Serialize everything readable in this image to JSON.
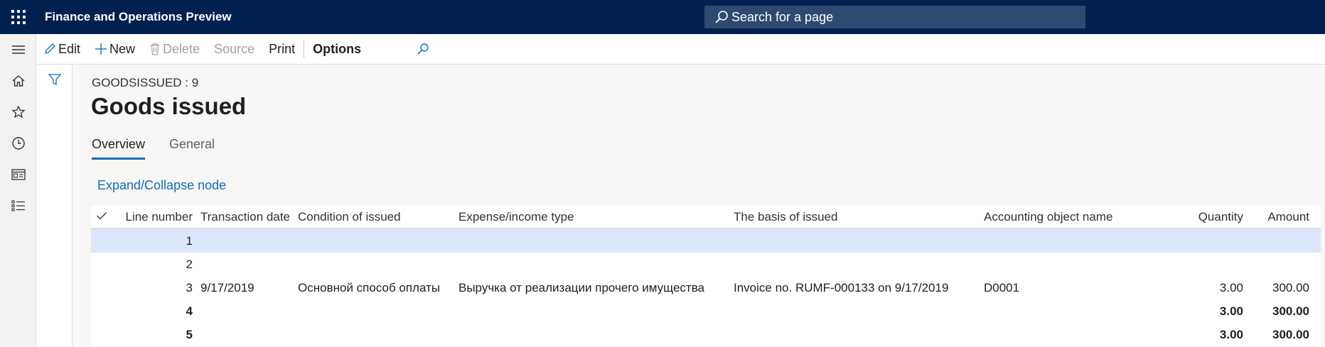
{
  "header": {
    "app_title": "Finance and Operations Preview",
    "search_placeholder": "Search for a page",
    "waffle_icon": "waffle-icon"
  },
  "rail": {
    "items": [
      "hamburger-icon",
      "home-icon",
      "star-icon",
      "clock-icon",
      "workspace-icon",
      "list-icon"
    ]
  },
  "actions": {
    "edit": "Edit",
    "new": "New",
    "delete": "Delete",
    "source": "Source",
    "print": "Print",
    "options": "Options"
  },
  "page": {
    "caption": "GOODSISSUED : 9",
    "title": "Goods issued",
    "tabs": [
      {
        "label": "Overview",
        "active": true
      },
      {
        "label": "General",
        "active": false
      }
    ],
    "expand_link": "Expand/Collapse node"
  },
  "grid": {
    "columns": {
      "line_number": "Line number",
      "transaction_date": "Transaction date",
      "condition": "Condition of issued",
      "expense_type": "Expense/income type",
      "basis": "The basis of issued",
      "accounting_object": "Accounting object name",
      "quantity": "Quantity",
      "amount": "Amount"
    },
    "rows": [
      {
        "line": "1",
        "date": "",
        "condition": "",
        "expense": "",
        "basis": "",
        "account": "",
        "qty": "",
        "amount": ""
      },
      {
        "line": "2",
        "date": "",
        "condition": "",
        "expense": "",
        "basis": "",
        "account": "",
        "qty": "",
        "amount": ""
      },
      {
        "line": "3",
        "date": "9/17/2019",
        "condition": "Основной способ оплаты",
        "expense": "Выручка от реализации прочего имущества",
        "basis": "Invoice no. RUMF-000133 on 9/17/2019",
        "account": "D0001",
        "qty": "3.00",
        "amount": "300.00"
      },
      {
        "line": "4",
        "date": "",
        "condition": "",
        "expense": "",
        "basis": "",
        "account": "",
        "qty": "3.00",
        "amount": "300.00"
      },
      {
        "line": "5",
        "date": "",
        "condition": "",
        "expense": "",
        "basis": "",
        "account": "",
        "qty": "3.00",
        "amount": "300.00"
      }
    ]
  },
  "colors": {
    "nav_bg": "#002050",
    "accent": "#0f6cbd",
    "selected_row": "#dde7fb"
  }
}
